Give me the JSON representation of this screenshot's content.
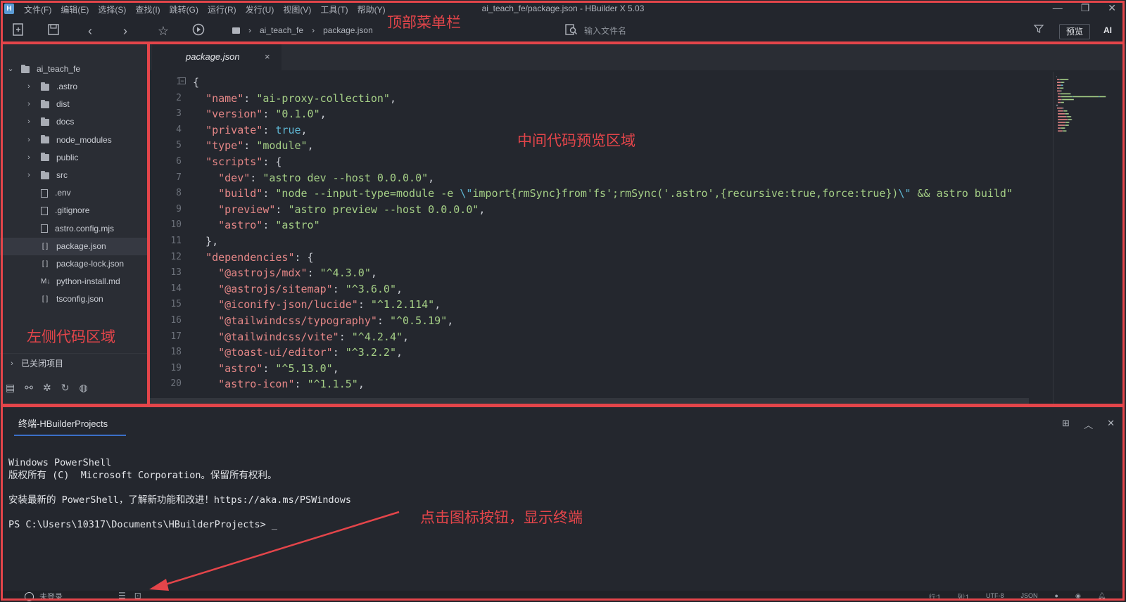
{
  "titlebar": {
    "menu": [
      "文件(F)",
      "编辑(E)",
      "选择(S)",
      "查找(I)",
      "跳转(G)",
      "运行(R)",
      "发行(U)",
      "视图(V)",
      "工具(T)",
      "帮助(Y)"
    ],
    "title": "ai_teach_fe/package.json - HBuilder X 5.03"
  },
  "toolbar": {
    "breadcrumb": [
      "ai_teach_fe",
      "package.json"
    ],
    "search_placeholder": "输入文件名",
    "preview_label": "预览",
    "ai_label": "AI"
  },
  "sidebar": {
    "project": "ai_teach_fe",
    "items": [
      {
        "label": ".astro",
        "kind": "folder"
      },
      {
        "label": "dist",
        "kind": "folder"
      },
      {
        "label": "docs",
        "kind": "folder"
      },
      {
        "label": "node_modules",
        "kind": "folder"
      },
      {
        "label": "public",
        "kind": "folder"
      },
      {
        "label": "src",
        "kind": "folder"
      },
      {
        "label": ".env",
        "kind": "file"
      },
      {
        "label": ".gitignore",
        "kind": "file"
      },
      {
        "label": "astro.config.mjs",
        "kind": "file"
      },
      {
        "label": "package.json",
        "kind": "json",
        "selected": true
      },
      {
        "label": "package-lock.json",
        "kind": "json"
      },
      {
        "label": "python-install.md",
        "kind": "md"
      },
      {
        "label": "tsconfig.json",
        "kind": "json"
      }
    ],
    "closed_projects": "已关闭项目"
  },
  "editor": {
    "tab": "package.json",
    "lines": [
      [
        [
          "p",
          "{"
        ]
      ],
      [
        [
          "p",
          "  "
        ],
        [
          "k",
          "\"name\""
        ],
        [
          "p",
          ": "
        ],
        [
          "s",
          "\"ai-proxy-collection\""
        ],
        [
          "p",
          ","
        ]
      ],
      [
        [
          "p",
          "  "
        ],
        [
          "k",
          "\"version\""
        ],
        [
          "p",
          ": "
        ],
        [
          "s",
          "\"0.1.0\""
        ],
        [
          "p",
          ","
        ]
      ],
      [
        [
          "p",
          "  "
        ],
        [
          "k",
          "\"private\""
        ],
        [
          "p",
          ": "
        ],
        [
          "b",
          "true"
        ],
        [
          "p",
          ","
        ]
      ],
      [
        [
          "p",
          "  "
        ],
        [
          "k",
          "\"type\""
        ],
        [
          "p",
          ": "
        ],
        [
          "s",
          "\"module\""
        ],
        [
          "p",
          ","
        ]
      ],
      [
        [
          "p",
          "  "
        ],
        [
          "k",
          "\"scripts\""
        ],
        [
          "p",
          ": {"
        ]
      ],
      [
        [
          "p",
          "    "
        ],
        [
          "k",
          "\"dev\""
        ],
        [
          "p",
          ": "
        ],
        [
          "s",
          "\"astro dev --host 0.0.0.0\""
        ],
        [
          "p",
          ","
        ]
      ],
      [
        [
          "p",
          "    "
        ],
        [
          "k",
          "\"build\""
        ],
        [
          "p",
          ": "
        ],
        [
          "s",
          "\"node --input-type=module -e "
        ],
        [
          "b",
          "\\\""
        ],
        [
          "s",
          "import{rmSync}from'fs';rmSync('.astro',{recursive:true,force:true})"
        ],
        [
          "b",
          "\\\""
        ],
        [
          "s",
          " && astro build\""
        ]
      ],
      [
        [
          "p",
          "    "
        ],
        [
          "k",
          "\"preview\""
        ],
        [
          "p",
          ": "
        ],
        [
          "s",
          "\"astro preview --host 0.0.0.0\""
        ],
        [
          "p",
          ","
        ]
      ],
      [
        [
          "p",
          "    "
        ],
        [
          "k",
          "\"astro\""
        ],
        [
          "p",
          ": "
        ],
        [
          "s",
          "\"astro\""
        ]
      ],
      [
        [
          "p",
          "  },"
        ]
      ],
      [
        [
          "p",
          "  "
        ],
        [
          "k",
          "\"dependencies\""
        ],
        [
          "p",
          ": {"
        ]
      ],
      [
        [
          "p",
          "    "
        ],
        [
          "k",
          "\"@astrojs/mdx\""
        ],
        [
          "p",
          ": "
        ],
        [
          "s",
          "\"^4.3.0\""
        ],
        [
          "p",
          ","
        ]
      ],
      [
        [
          "p",
          "    "
        ],
        [
          "k",
          "\"@astrojs/sitemap\""
        ],
        [
          "p",
          ": "
        ],
        [
          "s",
          "\"^3.6.0\""
        ],
        [
          "p",
          ","
        ]
      ],
      [
        [
          "p",
          "    "
        ],
        [
          "k",
          "\"@iconify-json/lucide\""
        ],
        [
          "p",
          ": "
        ],
        [
          "s",
          "\"^1.2.114\""
        ],
        [
          "p",
          ","
        ]
      ],
      [
        [
          "p",
          "    "
        ],
        [
          "k",
          "\"@tailwindcss/typography\""
        ],
        [
          "p",
          ": "
        ],
        [
          "s",
          "\"^0.5.19\""
        ],
        [
          "p",
          ","
        ]
      ],
      [
        [
          "p",
          "    "
        ],
        [
          "k",
          "\"@tailwindcss/vite\""
        ],
        [
          "p",
          ": "
        ],
        [
          "s",
          "\"^4.2.4\""
        ],
        [
          "p",
          ","
        ]
      ],
      [
        [
          "p",
          "    "
        ],
        [
          "k",
          "\"@toast-ui/editor\""
        ],
        [
          "p",
          ": "
        ],
        [
          "s",
          "\"^3.2.2\""
        ],
        [
          "p",
          ","
        ]
      ],
      [
        [
          "p",
          "    "
        ],
        [
          "k",
          "\"astro\""
        ],
        [
          "p",
          ": "
        ],
        [
          "s",
          "\"^5.13.0\""
        ],
        [
          "p",
          ","
        ]
      ],
      [
        [
          "p",
          "    "
        ],
        [
          "k",
          "\"astro-icon\""
        ],
        [
          "p",
          ": "
        ],
        [
          "s",
          "\"^1.1.5\""
        ],
        [
          "p",
          ","
        ]
      ]
    ]
  },
  "terminal": {
    "tab": "终端-HBuilderProjects",
    "output": "Windows PowerShell\n版权所有 (C)  Microsoft Corporation。保留所有权利。\n\n安装最新的 PowerShell，了解新功能和改进！https://aka.ms/PSWindows\n\nPS C:\\Users\\10317\\Documents\\HBuilderProjects> _"
  },
  "statusbar": {
    "user": "未登录",
    "position_line": "行:1",
    "position_col": "列:1",
    "encoding": "UTF-8",
    "language": "JSON"
  },
  "annotations": {
    "top": "顶部菜单栏",
    "left": "左侧代码区域",
    "center": "中间代码预览区域",
    "terminal_hint": "点击图标按钮，显示终端"
  },
  "colors": {
    "annotation_red": "#e4454a",
    "json_key": "#e58787",
    "json_string": "#a5cf86",
    "json_keyword": "#5fb7d4"
  }
}
